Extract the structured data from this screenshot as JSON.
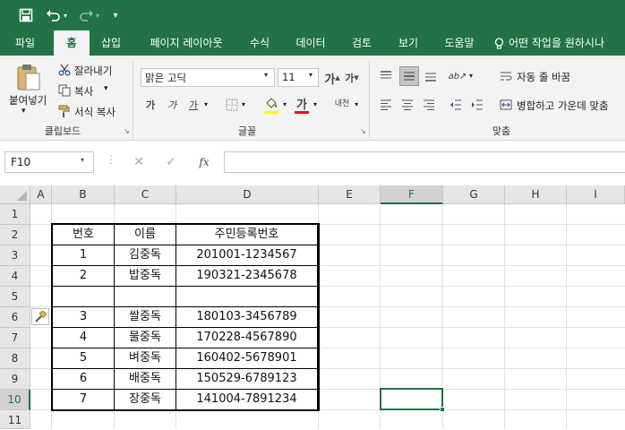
{
  "quick_access": {
    "save_icon": "save-icon",
    "undo_icon": "undo-icon",
    "redo_icon": "redo-icon",
    "customize_icon": "customize-icon"
  },
  "tabs": [
    "파일",
    "홈",
    "삽입",
    "페이지 레이아웃",
    "수식",
    "데이터",
    "검토",
    "보기",
    "도움말"
  ],
  "tell_me": "어떤 작업을 원하시나",
  "clipboard": {
    "paste": "붙여넣기",
    "cut": "잘라내기",
    "copy": "복사",
    "format_painter": "서식 복사",
    "group": "클립보드"
  },
  "font": {
    "name": "맑은 고딕",
    "size": "11",
    "group": "글꼴",
    "phonetic": "내천"
  },
  "alignment": {
    "wrap": "자동 줄 바꿈",
    "merge": "병합하고 가운데 맞춤",
    "group": "맞춤"
  },
  "formula_bar": {
    "name_box": "F10",
    "fx": "fx",
    "value": ""
  },
  "columns": [
    "A",
    "B",
    "C",
    "D",
    "E",
    "F",
    "G",
    "H",
    "I"
  ],
  "rows": [
    "1",
    "2",
    "3",
    "4",
    "5",
    "6",
    "7",
    "8",
    "9",
    "10",
    "11"
  ],
  "selected_cell": "F10",
  "table": {
    "header": [
      "번호",
      "이름",
      "주민등록번호"
    ],
    "rows": [
      [
        "1",
        "김중독",
        "201001-1234567"
      ],
      [
        "2",
        "밥중독",
        "190321-2345678"
      ],
      [
        "",
        "",
        ""
      ],
      [
        "3",
        "쌀중독",
        "180103-3456789"
      ],
      [
        "4",
        "물중독",
        "170228-4567890"
      ],
      [
        "5",
        "벼중독",
        "160402-5678901"
      ],
      [
        "6",
        "배중독",
        "150529-6789123"
      ],
      [
        "7",
        "장중독",
        "141004-7891234"
      ]
    ]
  },
  "colors": {
    "accent": "#217346",
    "font_color_bar": "#e81123"
  }
}
